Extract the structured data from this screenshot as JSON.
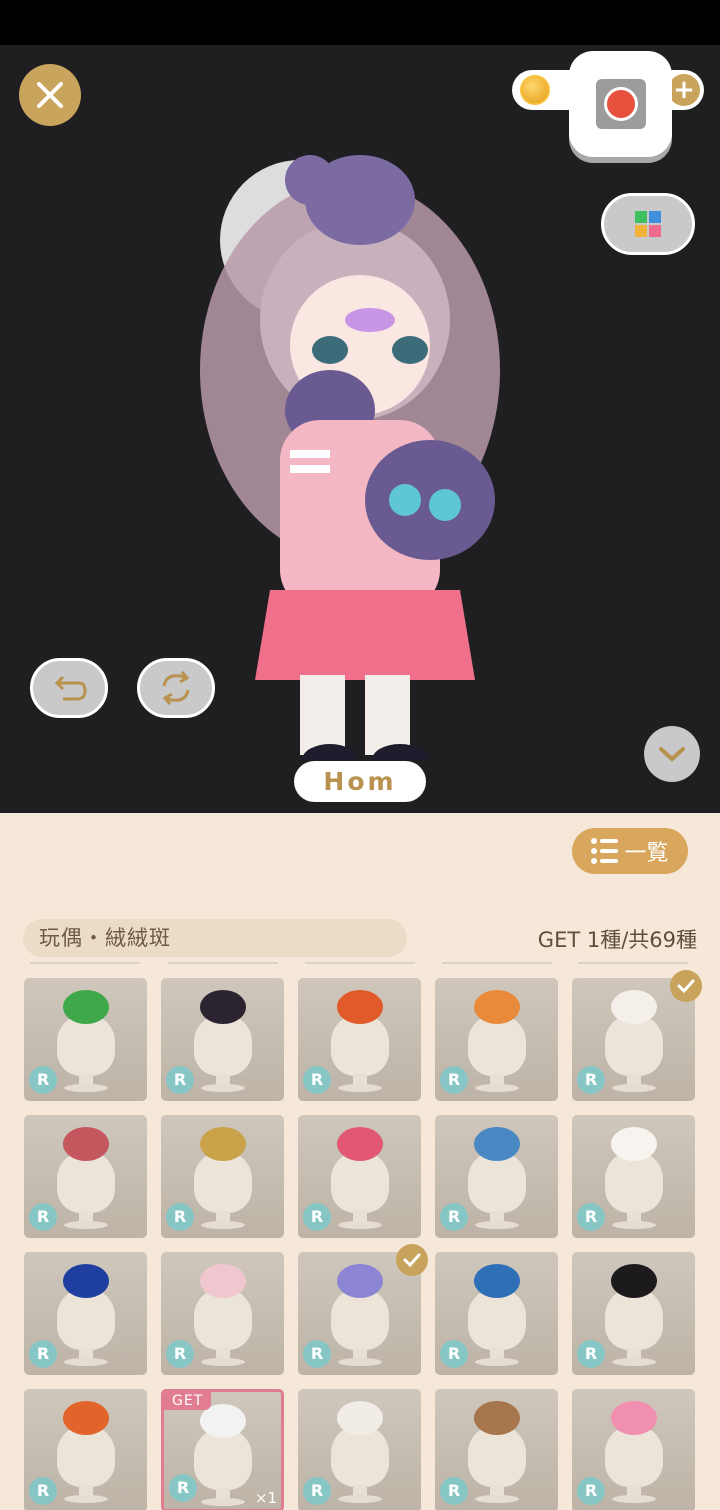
{
  "header": {
    "close_icon": "close-icon",
    "name": "Hom"
  },
  "panel": {
    "list_button_label": "一覧",
    "category": "玩偶・絨絨斑",
    "collection_count": "GET 1種/共69種"
  },
  "items": [
    {
      "rarity": "R",
      "color": "#3fa84a"
    },
    {
      "rarity": "R",
      "color": "#2b2430"
    },
    {
      "rarity": "R",
      "color": "#e05a2a"
    },
    {
      "rarity": "R",
      "color": "#e88a3a"
    },
    {
      "rarity": "R",
      "color": "#f4efe8",
      "owned": true
    },
    {
      "rarity": "R",
      "color": "#c4565e"
    },
    {
      "rarity": "R",
      "color": "#c9a24a"
    },
    {
      "rarity": "R",
      "color": "#e25872"
    },
    {
      "rarity": "R",
      "color": "#4a88c4"
    },
    {
      "rarity": "R",
      "color": "#f7f4ef"
    },
    {
      "rarity": "R",
      "color": "#1f3fa0"
    },
    {
      "rarity": "R",
      "color": "#f0c7cf"
    },
    {
      "rarity": "R",
      "color": "#8c84d4",
      "owned": true
    },
    {
      "rarity": "R",
      "color": "#2f6fb8"
    },
    {
      "rarity": "R",
      "color": "#1d1a1e"
    },
    {
      "rarity": "R",
      "color": "#e2642a"
    },
    {
      "rarity": "R",
      "color": "#f2f2f2",
      "get": "GET",
      "qty": "×1"
    },
    {
      "rarity": "R",
      "color": "#f1ede6"
    },
    {
      "rarity": "R",
      "color": "#a8764c"
    },
    {
      "rarity": "R",
      "color": "#f08fb0"
    }
  ]
}
